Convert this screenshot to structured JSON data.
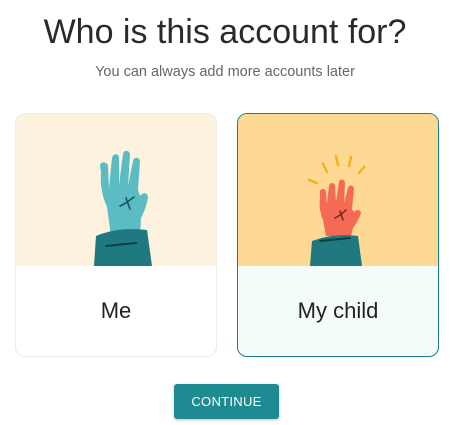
{
  "header": {
    "title": "Who is this account for?",
    "subtitle": "You can always add more accounts later"
  },
  "options": [
    {
      "label": "Me",
      "illustration": "raised-hand-icon",
      "selected": false
    },
    {
      "label": "My child",
      "illustration": "raised-hand-sparkle-icon",
      "selected": true
    }
  ],
  "actions": {
    "continue_label": "CONTINUE"
  },
  "colors": {
    "accent": "#1e8a92",
    "selected_border": "#1b7f86",
    "me_card_bg": "#fdf2dd",
    "child_card_bg": "#fdd993",
    "hand_me": "#5bbcc4",
    "hand_child": "#f46a55",
    "sleeve": "#1e7a80",
    "sparkle": "#f3b31d"
  }
}
